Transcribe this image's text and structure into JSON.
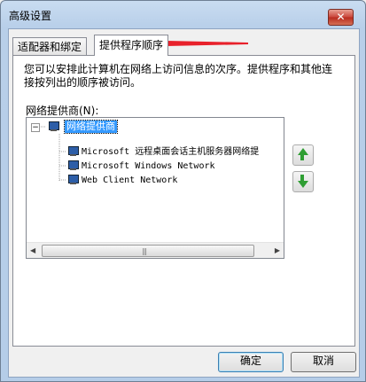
{
  "window": {
    "title": "高级设置",
    "close_label": "✕"
  },
  "tabs": [
    {
      "label": "适配器和绑定"
    },
    {
      "label": "提供程序顺序"
    }
  ],
  "description": "您可以安排此计算机在网络上访问信息的次序。提供程序和其他连接按列出的顺序被访问。",
  "group": {
    "label": "网络提供商(N):"
  },
  "tree": {
    "root": "网络提供商",
    "items": [
      "Microsoft 远程桌面会话主机服务器网络提",
      "Microsoft Windows Network",
      "Web Client Network"
    ]
  },
  "buttons": {
    "ok": "确定",
    "cancel": "取消"
  },
  "colors": {
    "selection": "#3399ff",
    "annotation_arrow": "#e8212b",
    "move_arrows": "#2f9e33"
  }
}
